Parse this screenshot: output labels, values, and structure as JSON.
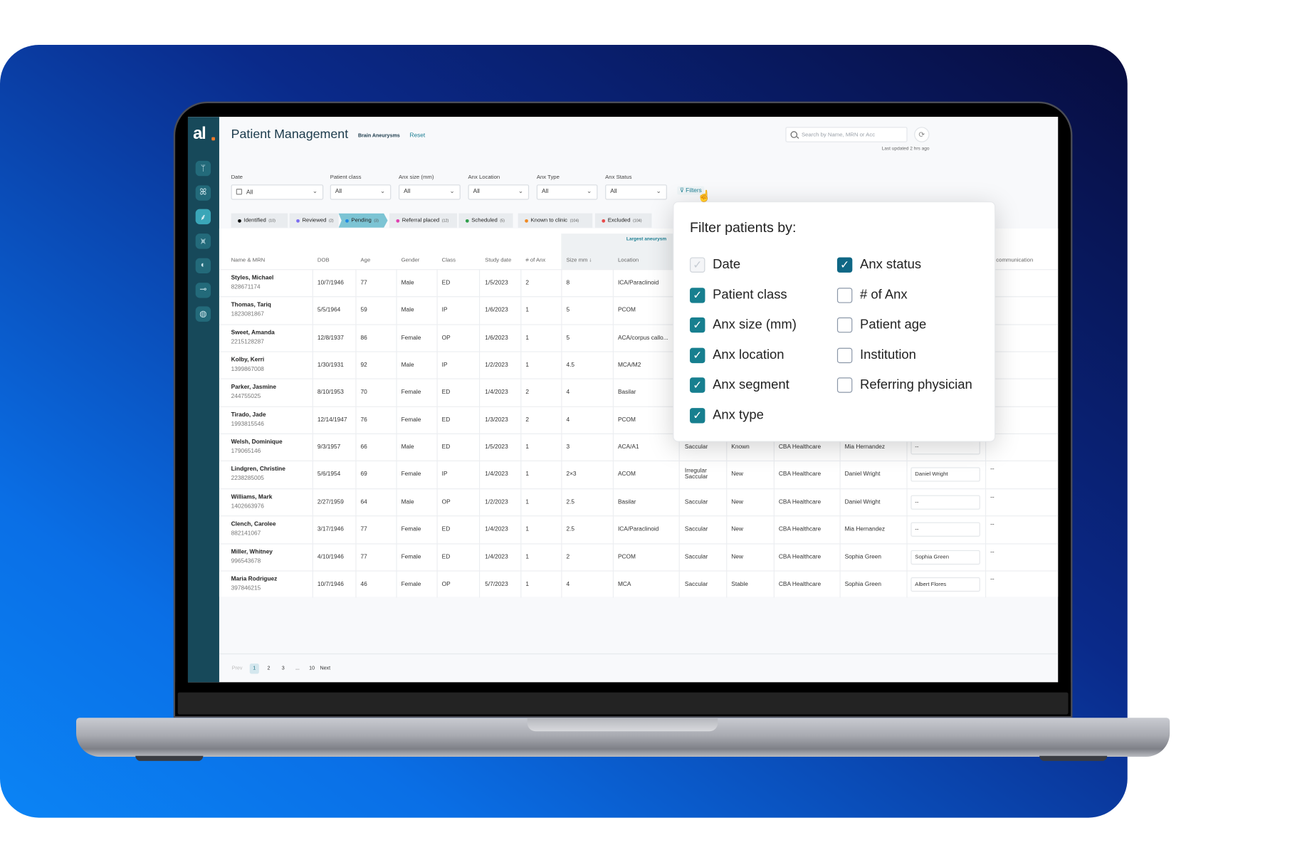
{
  "app": {
    "title": "Patient Management",
    "subtitle": "Brain Aneurysms",
    "reset_label": "Reset",
    "logo": "al"
  },
  "sidebar": {
    "icons": [
      "aorta-icon",
      "lungs-icon",
      "vessel-icon",
      "tree-icon",
      "kidney-icon",
      "probe-icon",
      "globe-icon"
    ],
    "active_index": 2
  },
  "search": {
    "placeholder": "Search by Name, MRN or Acc",
    "last_updated": "Last updated 2 hrs ago"
  },
  "filters": [
    {
      "label": "Date",
      "value": "All"
    },
    {
      "label": "Patient class",
      "value": "All"
    },
    {
      "label": "Anx size (mm)",
      "value": "All"
    },
    {
      "label": "Anx Location",
      "value": "All"
    },
    {
      "label": "Anx Type",
      "value": "All"
    },
    {
      "label": "Anx Status",
      "value": "All"
    }
  ],
  "filters_button": "Filters",
  "status_tabs": [
    {
      "label": "Identified",
      "count": "(10)",
      "color": "#111111"
    },
    {
      "label": "Reviewed",
      "count": "(2)",
      "color": "#7b6cf0"
    },
    {
      "label": "Pending",
      "count": "(3)",
      "color": "#1e88e5",
      "active": true
    },
    {
      "label": "Referral placed",
      "count": "(12)",
      "color": "#e040b0"
    },
    {
      "label": "Scheduled",
      "count": "(5)",
      "color": "#2e9e4a"
    },
    {
      "label": "Known to clinic",
      "count": "(104)",
      "color": "#f08a24"
    },
    {
      "label": "Excluded",
      "count": "(104)",
      "color": "#e84a4a"
    }
  ],
  "table": {
    "group_label": "Largest aneurysm",
    "columns": [
      "Name & MRN",
      "DOB",
      "Age",
      "Gender",
      "Class",
      "Study date",
      "# of Anx",
      "Size mm ↓",
      "Location",
      "st communication"
    ],
    "rows": [
      {
        "name": "Styles, Michael",
        "mrn": "828671174",
        "dob": "10/7/1946",
        "age": "77",
        "gender": "Male",
        "class": "ED",
        "study": "1/5/2023",
        "num": "2",
        "size": "8",
        "location": "ICA/Paraclinoid"
      },
      {
        "name": "Thomas, Tariq",
        "mrn": "1823081867",
        "dob": "5/5/1964",
        "age": "59",
        "gender": "Male",
        "class": "IP",
        "study": "1/6/2023",
        "num": "1",
        "size": "5",
        "location": "PCOM"
      },
      {
        "name": "Sweet, Amanda",
        "mrn": "2215128287",
        "dob": "12/8/1937",
        "age": "86",
        "gender": "Female",
        "class": "OP",
        "study": "1/6/2023",
        "num": "1",
        "size": "5",
        "location": "ACA/corpus callo..."
      },
      {
        "name": "Kolby, Kerri",
        "mrn": "1399867008",
        "dob": "1/30/1931",
        "age": "92",
        "gender": "Male",
        "class": "IP",
        "study": "1/2/2023",
        "num": "1",
        "size": "4.5",
        "location": "MCA/M2"
      },
      {
        "name": "Parker, Jasmine",
        "mrn": "244755025",
        "dob": "8/10/1953",
        "age": "70",
        "gender": "Female",
        "class": "ED",
        "study": "1/4/2023",
        "num": "2",
        "size": "4",
        "location": "Basilar"
      },
      {
        "name": "Tirado, Jade",
        "mrn": "1993815546",
        "dob": "12/14/1947",
        "age": "76",
        "gender": "Female",
        "class": "ED",
        "study": "1/3/2023",
        "num": "2",
        "size": "4",
        "location": "PCOM"
      },
      {
        "name": "Welsh, Dominique",
        "mrn": "179065146",
        "dob": "9/3/1957",
        "age": "66",
        "gender": "Male",
        "class": "ED",
        "study": "1/5/2023",
        "num": "1",
        "size": "3",
        "location": "ACA/A1",
        "type": "Saccular",
        "status": "Known",
        "institution": "CBA Healthcare",
        "referring": "Mia Hernandez",
        "assigned": "--"
      },
      {
        "name": "Lindgren, Christine",
        "mrn": "2238285005",
        "dob": "5/6/1954",
        "age": "69",
        "gender": "Female",
        "class": "IP",
        "study": "1/4/2023",
        "num": "1",
        "size": "2×3",
        "location": "ACOM",
        "type": "Irregular Saccular",
        "status": "New",
        "institution": "CBA Healthcare",
        "referring": "Daniel Wright",
        "assigned": "Daniel Wright",
        "last": "--"
      },
      {
        "name": "Williams, Mark",
        "mrn": "1402663976",
        "dob": "2/27/1959",
        "age": "64",
        "gender": "Male",
        "class": "OP",
        "study": "1/2/2023",
        "num": "1",
        "size": "2.5",
        "location": "Basilar",
        "type": "Saccular",
        "status": "New",
        "institution": "CBA Healthcare",
        "referring": "Daniel Wright",
        "assigned": "--",
        "last": "--"
      },
      {
        "name": "Clench, Carolee",
        "mrn": "882141067",
        "dob": "3/17/1946",
        "age": "77",
        "gender": "Female",
        "class": "ED",
        "study": "1/4/2023",
        "num": "1",
        "size": "2.5",
        "location": "ICA/Paraclinoid",
        "type": "Saccular",
        "status": "New",
        "institution": "CBA Healthcare",
        "referring": "Mia Hernandez",
        "assigned": "--",
        "last": "--"
      },
      {
        "name": "Miller, Whitney",
        "mrn": "996543678",
        "dob": "4/10/1946",
        "age": "77",
        "gender": "Female",
        "class": "ED",
        "study": "1/4/2023",
        "num": "1",
        "size": "2",
        "location": "PCOM",
        "type": "Saccular",
        "status": "New",
        "institution": "CBA Healthcare",
        "referring": "Sophia Green",
        "assigned": "Sophia Green",
        "last": "--"
      },
      {
        "name": "Maria Rodriguez",
        "mrn": "397846215",
        "dob": "10/7/1946",
        "age": "46",
        "gender": "Female",
        "class": "OP",
        "study": "5/7/2023",
        "num": "1",
        "size": "4",
        "location": "MCA",
        "type": "Saccular",
        "status": "Stable",
        "institution": "CBA Healthcare",
        "referring": "Sophia Green",
        "assigned": "Albert Flores",
        "last": "--"
      }
    ]
  },
  "pagination": {
    "prev": "Prev",
    "pages": [
      "1",
      "2",
      "3",
      "...",
      "10"
    ],
    "current": "1",
    "next": "Next"
  },
  "filter_popup": {
    "title": "Filter patients by:",
    "left": [
      {
        "label": "Date",
        "checked": true,
        "disabled": true
      },
      {
        "label": "Patient class",
        "checked": true
      },
      {
        "label": "Anx size (mm)",
        "checked": true
      },
      {
        "label": "Anx location",
        "checked": true
      },
      {
        "label": "Anx segment",
        "checked": true
      },
      {
        "label": "Anx type",
        "checked": true
      }
    ],
    "right": [
      {
        "label": "Anx status",
        "checked": true
      },
      {
        "label": "# of Anx",
        "checked": false
      },
      {
        "label": "Patient age",
        "checked": false
      },
      {
        "label": "Institution",
        "checked": false
      },
      {
        "label": "Referring physician",
        "checked": false
      }
    ]
  },
  "colors": {
    "sidebar": "#17495a",
    "accent": "#1d7f93",
    "checkbox": "#177f8f",
    "active_tab": "#7cc4d4"
  }
}
